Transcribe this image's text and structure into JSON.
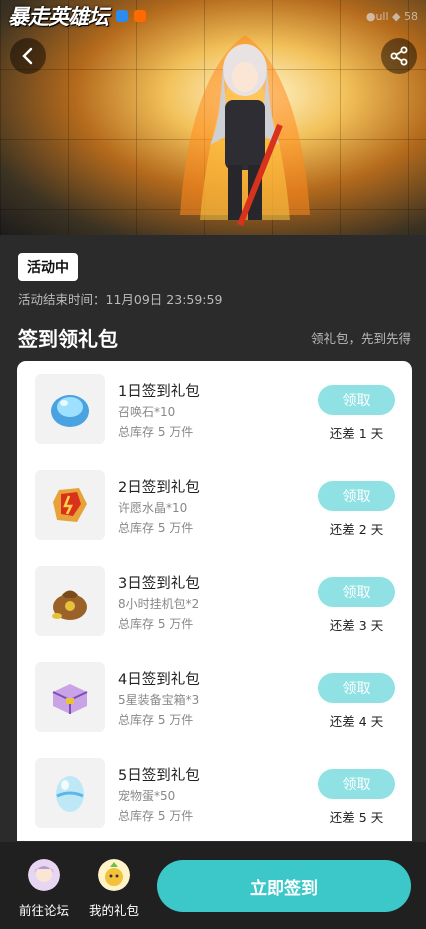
{
  "status_bar": {
    "app_logo_text": "暴走英雄坛",
    "right_text": "●ull ◆ 58"
  },
  "activity": {
    "badge": "活动中",
    "end_time": "活动结束时间：11月09日 23:59:59"
  },
  "section": {
    "title": "签到领礼包",
    "hint": "领礼包，先到先得"
  },
  "rewards": [
    {
      "title": "1日签到礼包",
      "item": "召唤石*10",
      "stock": "总库存 5 万件",
      "button": "领取",
      "remaining": "还差 1 天",
      "icon": "summon-stone-icon",
      "color": "#5ab8e8"
    },
    {
      "title": "2日签到礼包",
      "item": "许愿水晶*10",
      "stock": "总库存 5 万件",
      "button": "领取",
      "remaining": "还差 2 天",
      "icon": "wish-crystal-icon",
      "color": "#e8a23a"
    },
    {
      "title": "3日签到礼包",
      "item": "8小时挂机包*2",
      "stock": "总库存 5 万件",
      "button": "领取",
      "remaining": "还差 3 天",
      "icon": "idle-bag-icon",
      "color": "#b5782e"
    },
    {
      "title": "4日签到礼包",
      "item": "5星装备宝箱*3",
      "stock": "总库存 5 万件",
      "button": "领取",
      "remaining": "还差 4 天",
      "icon": "equipment-chest-icon",
      "color": "#c9a3e6"
    },
    {
      "title": "5日签到礼包",
      "item": "宠物蛋*50",
      "stock": "总库存 5 万件",
      "button": "领取",
      "remaining": "还差 5 天",
      "icon": "pet-egg-icon",
      "color": "#9fd8ef"
    }
  ],
  "bottom_bar": {
    "forum_label": "前往论坛",
    "gifts_label": "我的礼包",
    "signin_label": "立即签到"
  },
  "colors": {
    "accent": "#3cc7c8",
    "claim_button": "#8fe1e3",
    "background": "#2b2b2b"
  }
}
